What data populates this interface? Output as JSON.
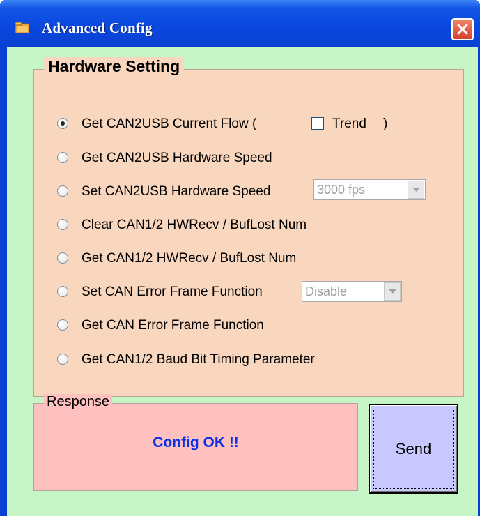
{
  "window": {
    "title": "Advanced Config",
    "title_bar_color": "#0a48df",
    "icons": {
      "app": "folder-icon",
      "close": "close-icon"
    }
  },
  "hardware": {
    "title": "Hardware Setting",
    "background": "#f9d7bf",
    "options": [
      {
        "label": "Get CAN2USB Current Flow  (",
        "selected": true
      },
      {
        "label": "Get CAN2USB Hardware Speed",
        "selected": false
      },
      {
        "label": "Set CAN2USB Hardware Speed",
        "selected": false
      },
      {
        "label": "Clear CAN1/2 HWRecv / BufLost Num",
        "selected": false
      },
      {
        "label": "Get CAN1/2 HWRecv / BufLost Num",
        "selected": false
      },
      {
        "label": "Set CAN Error Frame Function",
        "selected": false
      },
      {
        "label": "Get CAN Error Frame Function",
        "selected": false
      },
      {
        "label": "Get CAN1/2 Baud Bit Timing Parameter",
        "selected": false
      }
    ],
    "trend": {
      "label": "Trend",
      "close_paren": ")",
      "checked": false
    },
    "speed_select": {
      "value": "3000 fps",
      "disabled": true
    },
    "error_frame_select": {
      "value": "Disable",
      "disabled": true
    }
  },
  "response": {
    "title": "Response",
    "message": "Config OK !!",
    "message_color": "#0a30e8",
    "background": "#ffc0c0"
  },
  "send": {
    "label": "Send",
    "background": "#c8c8ff"
  }
}
